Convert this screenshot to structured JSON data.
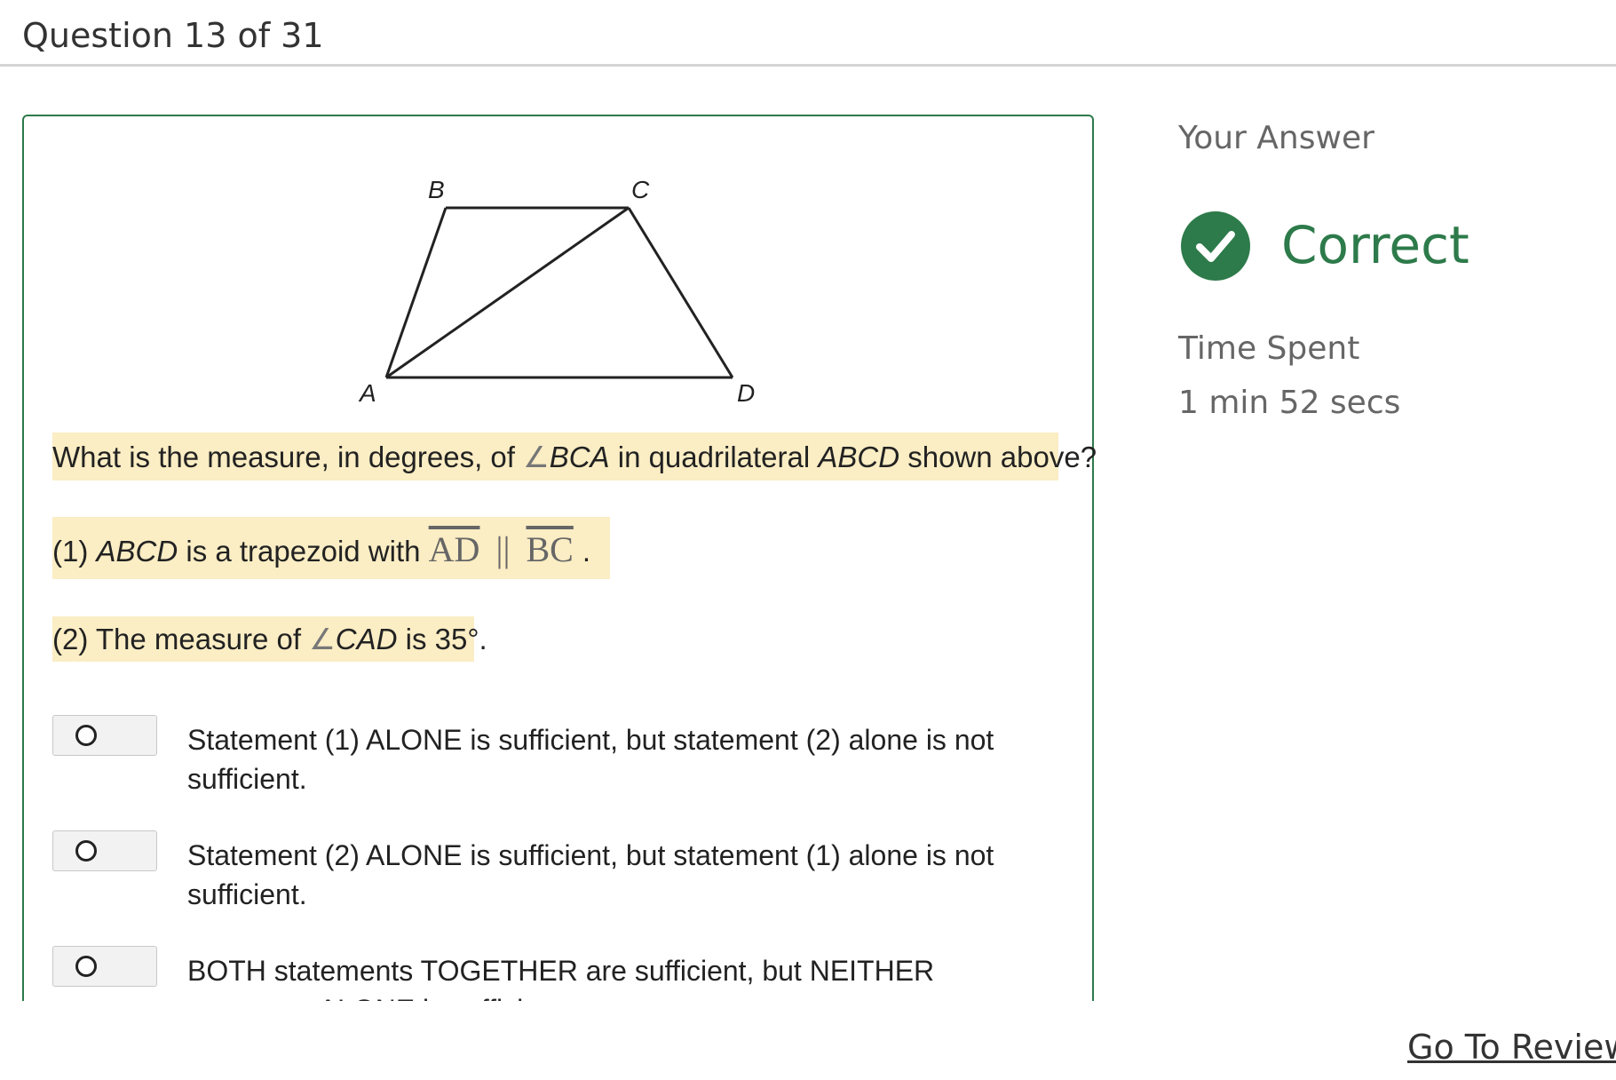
{
  "header": {
    "title": "Question 13 of 31"
  },
  "diagram": {
    "labels": {
      "a": "A",
      "b": "B",
      "c": "C",
      "d": "D"
    }
  },
  "question": {
    "stem": {
      "before": "What is the measure, in degrees, of ",
      "angle": "BCA",
      "middle": " in quadrilateral ",
      "shape": "ABCD",
      "after": " shown above?"
    },
    "statement1": {
      "prefix": "(1) ",
      "shape": "ABCD",
      "text": " is a trapezoid with ",
      "seg1": "AD",
      "parallel": "||",
      "seg2": "BC",
      "end": "."
    },
    "statement2": {
      "prefix": "(2) The measure of ",
      "angle": "CAD",
      "after": " is 35°."
    }
  },
  "choices": [
    {
      "text": "Statement (1) ALONE is sufficient, but statement (2) alone is not sufficient."
    },
    {
      "text": "Statement (2) ALONE is sufficient, but statement (1) alone is not sufficient."
    },
    {
      "text": "BOTH statements TOGETHER are sufficient, but NEITHER statement ALONE is sufficient."
    }
  ],
  "sidebar": {
    "your_answer_label": "Your Answer",
    "result": "Correct",
    "result_icon": "check-circle-icon",
    "time_spent_label": "Time Spent",
    "time_spent_value": "1 min 52 secs"
  },
  "footer": {
    "go_to_review": "Go To Review"
  },
  "colors": {
    "correct_green": "#2d7a4a",
    "highlight": "#fbedc4",
    "border": "#2d7a4a"
  }
}
